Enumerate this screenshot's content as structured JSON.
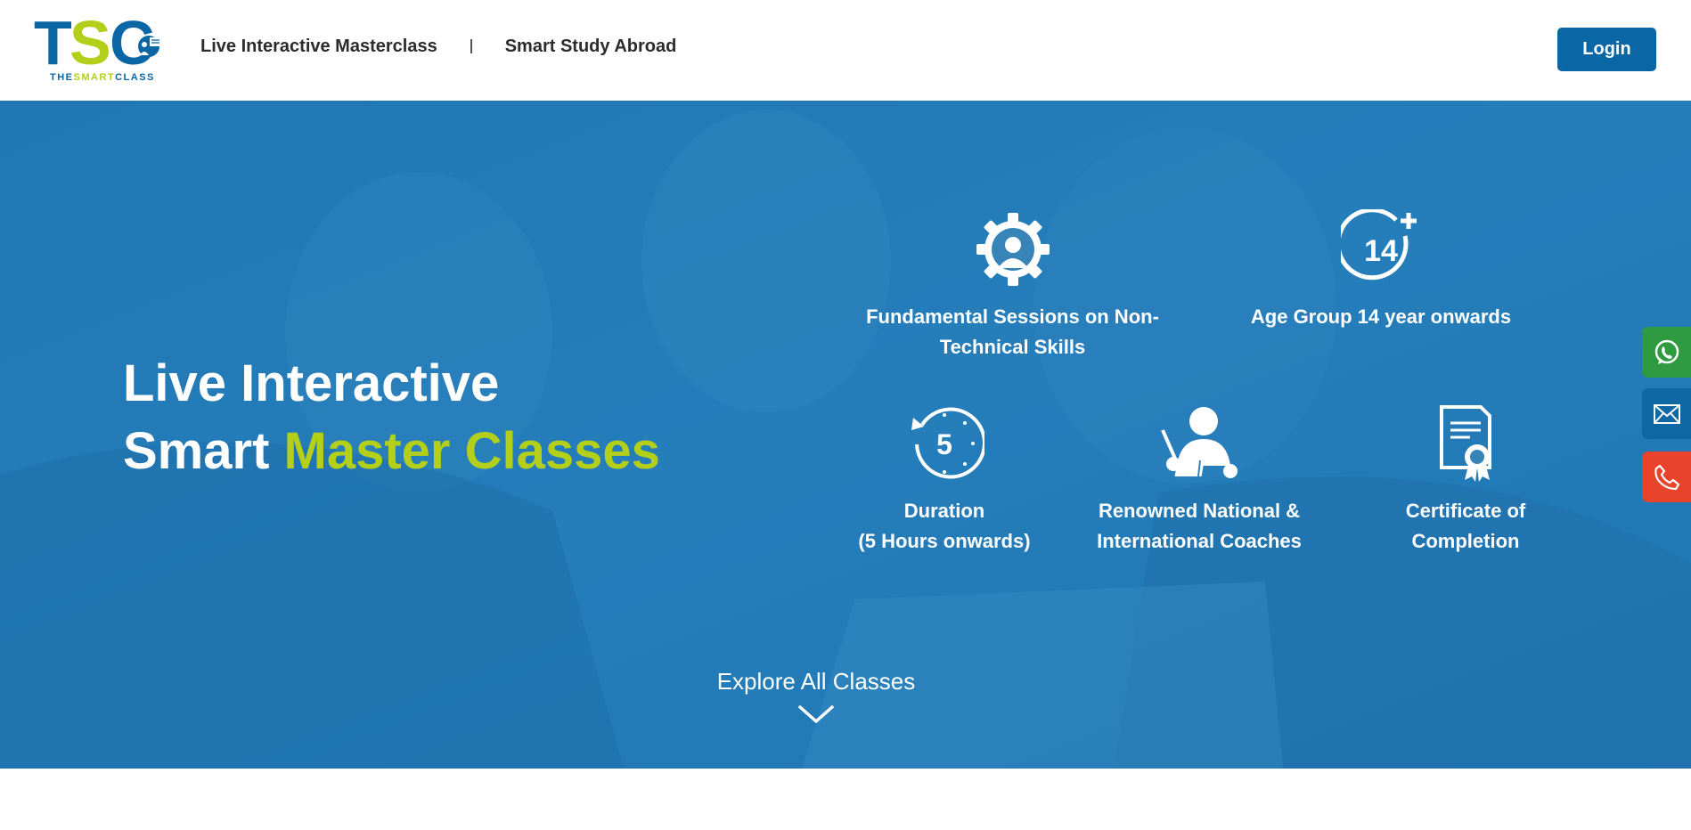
{
  "header": {
    "logo": {
      "letters": "TSC",
      "tagline": "THESMARTCLASS",
      "icon": "teacher-board-icon"
    },
    "nav": [
      {
        "label": "Live Interactive Masterclass"
      },
      {
        "label": "Smart Study Abroad"
      }
    ],
    "login_label": "Login"
  },
  "hero": {
    "title_line1": "Live Interactive",
    "title_line2_white": "Smart ",
    "title_line2_accent": "Master Classes",
    "features": [
      {
        "icon": "gear-person-icon",
        "line1": "Fundamental Sessions on Non-",
        "line2": "Technical Skills"
      },
      {
        "icon": "age-14-plus-icon",
        "badge": "14",
        "line1": "Age Group 14 year onwards",
        "line2": ""
      },
      {
        "icon": "clock-5-icon",
        "badge": "5",
        "line1": "Duration",
        "line2": "(5 Hours onwards)"
      },
      {
        "icon": "coach-teaching-icon",
        "line1": "Renowned National &",
        "line2": "International Coaches"
      },
      {
        "icon": "certificate-icon",
        "line1": "Certificate of",
        "line2": "Completion"
      }
    ],
    "explore_label": "Explore All Classes",
    "explore_icon": "chevron-down-icon"
  },
  "side_contacts": [
    {
      "icon": "whatsapp-icon"
    },
    {
      "icon": "mail-icon"
    },
    {
      "icon": "phone-icon"
    }
  ],
  "colors": {
    "brand_blue": "#0a66a4",
    "brand_green": "#b3cf1a",
    "hero_overlay": "#3684b8",
    "whatsapp_green": "#2f9a3f",
    "phone_red": "#e9432b"
  }
}
